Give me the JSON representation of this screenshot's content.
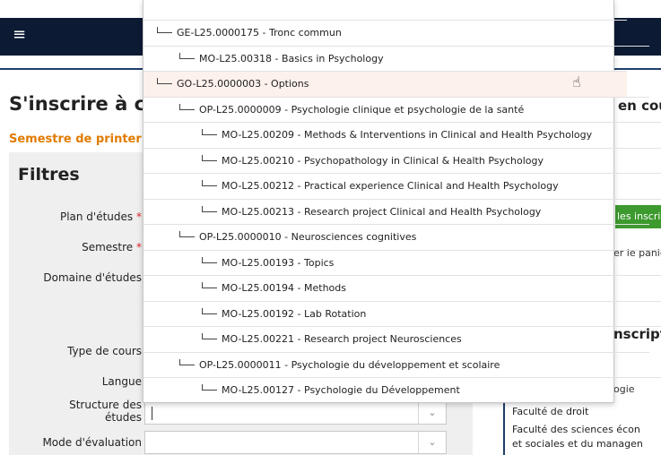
{
  "header": {
    "menu_icon": "hamburger-menu-icon",
    "menu_glyph": "≡"
  },
  "page": {
    "title": "S'inscrire à c",
    "subtitle": "Semestre de printer"
  },
  "filters": {
    "title": "Filtres",
    "fields": [
      {
        "label": "Plan d'études",
        "required": true
      },
      {
        "label": "Semestre",
        "required": true
      },
      {
        "label": "Domaine d'études",
        "required": false
      },
      {
        "label": "Type de cours",
        "required": false
      },
      {
        "label": "Langue",
        "required": false
      },
      {
        "label": "Structure des études",
        "required": false,
        "value": ""
      },
      {
        "label": "Mode d'évaluation",
        "required": false,
        "value": ""
      }
    ],
    "required_mark": "*",
    "chevron_glyph": "⌄"
  },
  "right_panel": {
    "title_partial": "en cou",
    "button_partial": "les inscrip",
    "panier_partial": "er le panie",
    "title2_partial": "nscript",
    "ogie_partial": "ogie",
    "faculties": [
      "Faculté de droit",
      "Faculté des sciences écon",
      "et sociales et du managen"
    ]
  },
  "dropdown": {
    "items": [
      {
        "text": "GE-L25.0000175 - Tronc commun",
        "level": 0
      },
      {
        "text": "MO-L25.00318 - Basics in Psychology",
        "level": 1
      },
      {
        "text": "GO-L25.0000003 - Options",
        "level": 0,
        "highlighted": true
      },
      {
        "text": "OP-L25.0000009 - Psychologie clinique et psychologie de la santé",
        "level": 1
      },
      {
        "text": "MO-L25.00209 - Methods & Interventions in Clinical and Health Psychology",
        "level": 2
      },
      {
        "text": "MO-L25.00210 - Psychopathology in Clinical & Health Psychology",
        "level": 2
      },
      {
        "text": "MO-L25.00212 - Practical experience Clinical and Health Psychology",
        "level": 2
      },
      {
        "text": "MO-L25.00213 - Research project Clinical and Health Psychology",
        "level": 2
      },
      {
        "text": "OP-L25.0000010 - Neurosciences cognitives",
        "level": 1
      },
      {
        "text": "MO-L25.00193 - Topics",
        "level": 2
      },
      {
        "text": "MO-L25.00194 - Methods",
        "level": 2
      },
      {
        "text": "MO-L25.00192 - Lab Rotation",
        "level": 2
      },
      {
        "text": "MO-L25.00221 - Research project Neurosciences",
        "level": 2
      },
      {
        "text": "OP-L25.0000011 - Psychologie du développement et scolaire",
        "level": 1
      },
      {
        "text": "MO-L25.00127 - Psychologie du Développement",
        "level": 2
      }
    ],
    "cursor_icon": "hand-pointer-icon",
    "cursor_glyph": "☝"
  }
}
